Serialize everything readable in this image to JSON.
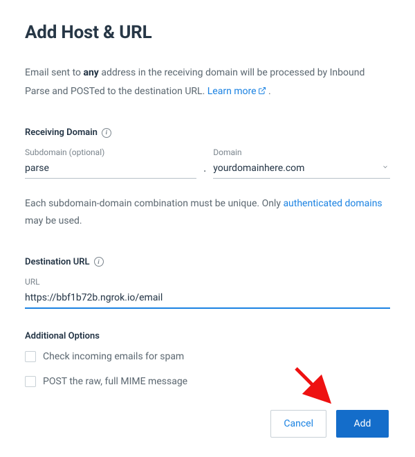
{
  "title": "Add Host & URL",
  "intro": {
    "prefix": "Email sent to ",
    "bold": "any",
    "suffix": " address in the receiving domain will be processed by Inbound Parse and POSTed to the destination URL. ",
    "link_text": "Learn more",
    "period": " ."
  },
  "receiving": {
    "section_label": "Receiving Domain",
    "subdomain_label": "Subdomain (optional)",
    "subdomain_value": "parse",
    "domain_label": "Domain",
    "domain_value": "yourdomainhere.com"
  },
  "unique_note": {
    "prefix": "Each subdomain-domain combination must be unique. Only ",
    "link_text": "authenticated domains",
    "suffix": " may be used."
  },
  "destination": {
    "section_label": "Destination URL",
    "url_label": "URL",
    "url_value": "https://bbf1b72b.ngrok.io/email"
  },
  "options": {
    "section_label": "Additional Options",
    "spam_label": "Check incoming emails for spam",
    "raw_label": "POST the raw, full MIME message"
  },
  "buttons": {
    "cancel": "Cancel",
    "add": "Add"
  }
}
